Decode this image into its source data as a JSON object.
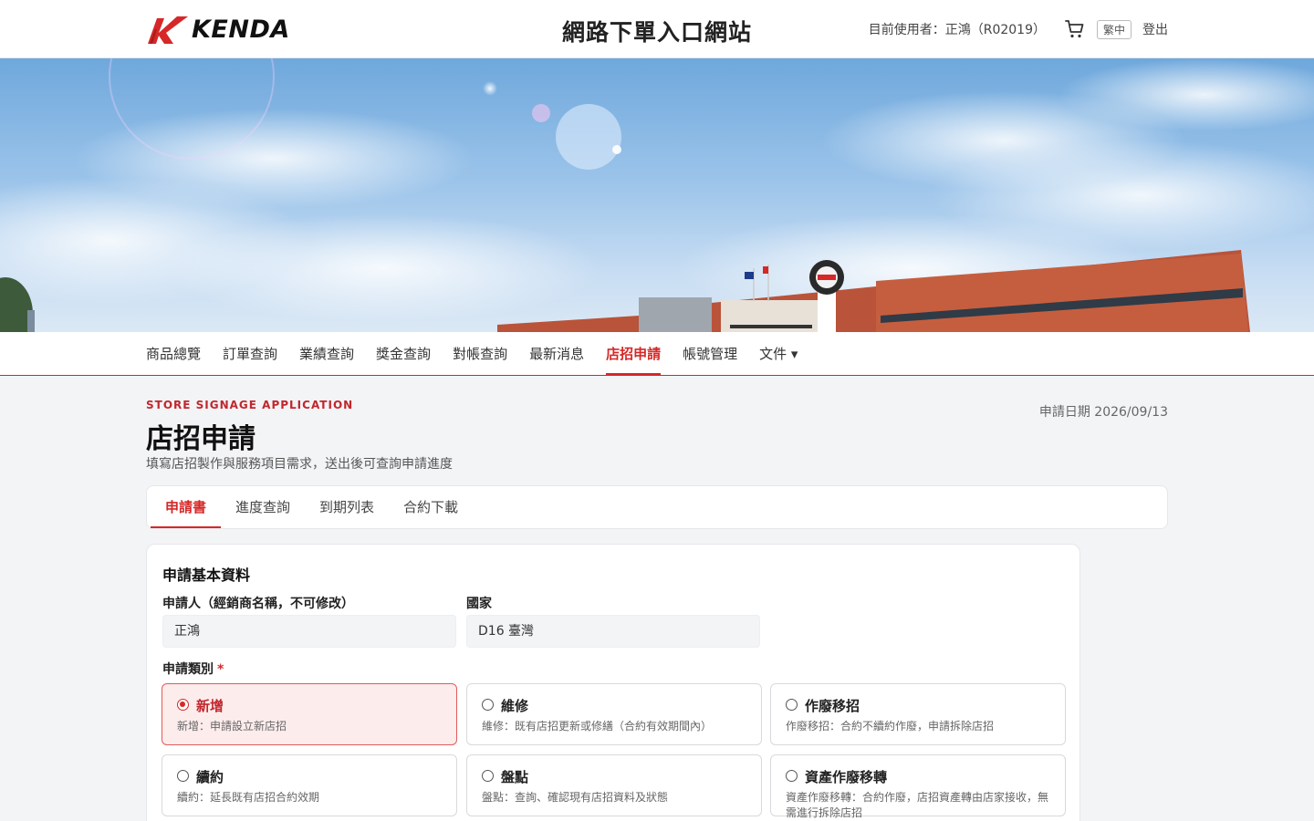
{
  "header": {
    "logo_text": "KENDA",
    "site_title": "網路下單入口網站",
    "user_label": "目前使用者：正鴻（R02019）",
    "lang": "繁中",
    "logout": "登出"
  },
  "nav": {
    "items": [
      {
        "label": "商品總覽"
      },
      {
        "label": "訂單查詢"
      },
      {
        "label": "業績查詢"
      },
      {
        "label": "獎金查詢"
      },
      {
        "label": "對帳查詢"
      },
      {
        "label": "最新消息"
      },
      {
        "label": "店招申請",
        "active": true
      },
      {
        "label": "帳號管理"
      },
      {
        "label": "文件 ▾"
      }
    ]
  },
  "page": {
    "eyebrow": "STORE SIGNAGE APPLICATION",
    "title": "店招申請",
    "subtitle": "填寫店招製作與服務項目需求，送出後可查詢申請進度",
    "apply_date": "申請日期 2026/09/13"
  },
  "tabs": [
    {
      "label": "申請書",
      "active": true
    },
    {
      "label": "進度查詢"
    },
    {
      "label": "到期列表"
    },
    {
      "label": "合約下載"
    }
  ],
  "form": {
    "section_title": "申請基本資料",
    "applicant": {
      "label": "申請人（經銷商名稱，不可修改）",
      "value": "正鴻"
    },
    "country": {
      "label": "國家",
      "value": "D16 臺灣"
    },
    "category": {
      "label": "申請類別",
      "required_mark": "*",
      "options": [
        {
          "title": "新增",
          "desc": "新增：申請設立新店招",
          "selected": true
        },
        {
          "title": "維修",
          "desc": "維修：既有店招更新或修繕（合約有效期間內）"
        },
        {
          "title": "作廢移招",
          "desc": "作廢移招：合約不續約作廢，申請拆除店招"
        },
        {
          "title": "續約",
          "desc": "續約：延長既有店招合約效期"
        },
        {
          "title": "盤點",
          "desc": "盤點：查詢、確認現有店招資料及狀態"
        },
        {
          "title": "資產作廢移轉",
          "desc": "資產作廢移轉：合約作廢，店招資產轉由店家接收，無需進行拆除店招"
        }
      ]
    }
  },
  "colors": {
    "accent": "#d62828",
    "selected_bg": "#fdecec"
  }
}
